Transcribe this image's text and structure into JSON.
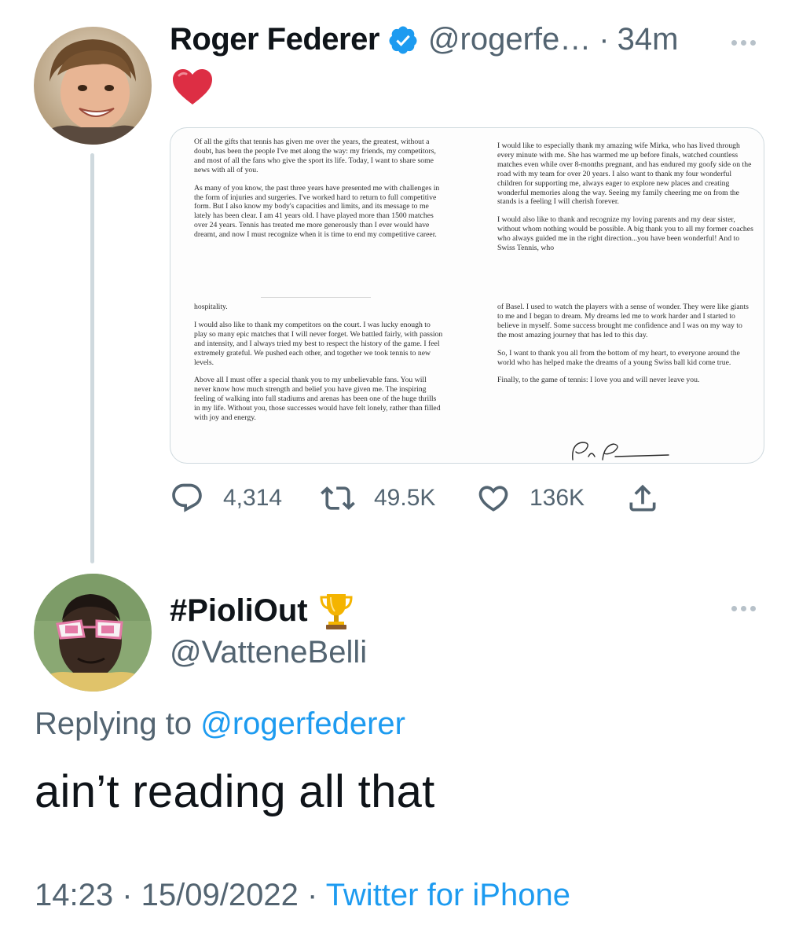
{
  "parent_tweet": {
    "display_name": "Roger Federer",
    "handle": "@rogerfe…",
    "separator": "·",
    "time": "34m",
    "avatar_icon": "child-photo-avatar",
    "text_emoji": "❤️",
    "letter": {
      "col_left": [
        "Of all the gifts that tennis has given me over the years, the greatest, without a doubt, has been the people I've met along the way: my friends, my competitors, and most of all the fans who give the sport its life. Today, I want to share some news with all of you.",
        "As many of you know, the past three years have presented me with challenges in the form of injuries and surgeries. I've worked hard to return to full competitive form. But I also know my body's capacities and limits, and its message to me lately has been clear. I am 41 years old. I have played more than 1500 matches over 24 years. Tennis has treated me more generously than I ever would have dreamt, and now I must recognize when it is time to end my competitive career."
      ],
      "col_right": [
        "I would like to especially thank my amazing wife Mirka, who has lived through every minute with me. She has warmed me up before finals, watched countless matches even while over 8-months pregnant, and has endured my goofy side on the road with my team for over 20 years. I also want to thank my four wonderful children for supporting me, always eager to explore new places and creating wonderful memories along the way. Seeing my family cheering me on from the stands is a feeling I will cherish forever.",
        "I would also like to thank and recognize my loving parents and my dear sister, without whom nothing would be possible. A big thank you to all my former coaches who always guided me in the right direction...you have been wonderful! And to Swiss Tennis, who"
      ],
      "col_left_2": [
        "hospitality.",
        "I would also like to thank my competitors on the court. I was lucky enough to play so many epic matches that I will never forget. We battled fairly, with passion and intensity, and I always tried my best to respect the history of the game. I feel extremely grateful. We pushed each other, and together we took tennis to new levels.",
        "Above all I must offer a special thank you to my unbelievable fans. You will never know how much strength and belief you have given me. The inspiring feeling of walking into full stadiums and arenas has been one of the huge thrills in my life. Without you, those successes would have felt lonely, rather than filled with joy and energy."
      ],
      "col_right_2": [
        "of Basel. I used to watch the players with a sense of wonder. They were like giants to me and I began to dream. My dreams led me to work harder and I started to believe in myself. Some success brought me confidence and I was on my way to the most amazing journey that has led to this day.",
        "So, I want to thank you all from the bottom of my heart, to everyone around the world who has helped make the dreams of a young Swiss ball kid come true.",
        "Finally, to the game of tennis: I love you and will never leave you."
      ]
    },
    "actions": {
      "reply_count": "4,314",
      "retweet_count": "49.5K",
      "like_count": "136K"
    }
  },
  "reply_tweet": {
    "display_name": "#PioliOut",
    "trophy_emoji": "trophy-icon",
    "handle": "@VatteneBelli",
    "replying_prefix": "Replying to ",
    "replying_to": "@rogerfederer",
    "text": "ain’t reading all that",
    "time": "14:23",
    "separator": " · ",
    "date": "15/09/2022",
    "source": "Twitter for iPhone"
  },
  "colors": {
    "accent": "#1d9bf0",
    "secondary_text": "#536471",
    "primary_text": "#0f1419",
    "divider": "#cfd9de"
  }
}
